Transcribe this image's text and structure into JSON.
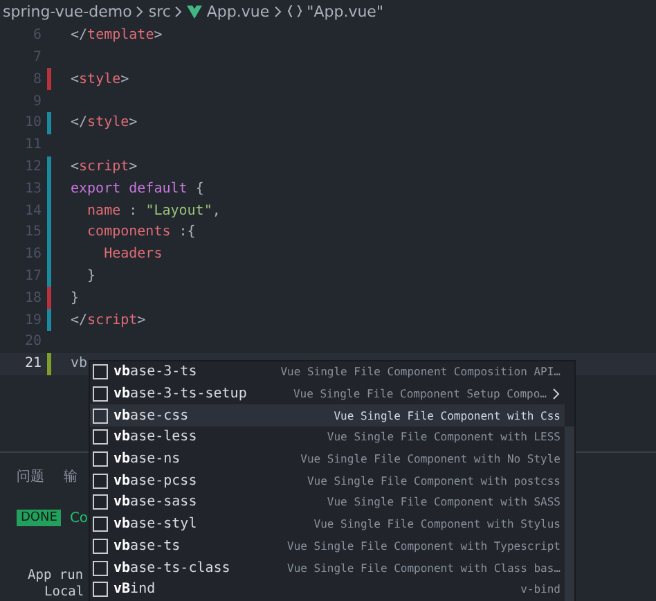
{
  "breadcrumb": [
    {
      "kind": "folder",
      "label": "spring-vue-demo"
    },
    {
      "kind": "folder",
      "label": "src"
    },
    {
      "kind": "vue-file",
      "label": "App.vue"
    },
    {
      "kind": "object",
      "label": "\"App.vue\""
    }
  ],
  "code_lines": [
    {
      "number": "6",
      "tokens": [
        {
          "kind": "punct",
          "text": "</"
        },
        {
          "kind": "tag",
          "text": "template"
        },
        {
          "kind": "punct",
          "text": ">"
        }
      ]
    },
    {
      "number": "7"
    },
    {
      "number": "8",
      "color": "#b8323c",
      "tokens": [
        {
          "kind": "punct",
          "text": "<"
        },
        {
          "kind": "tag",
          "text": "style"
        },
        {
          "kind": "punct",
          "text": ">"
        }
      ]
    },
    {
      "number": "9"
    },
    {
      "number": "10",
      "color": "#1b8a9f",
      "tokens": [
        {
          "kind": "punct",
          "text": "</"
        },
        {
          "kind": "tag",
          "text": "style"
        },
        {
          "kind": "punct",
          "text": ">"
        }
      ]
    },
    {
      "number": "11"
    },
    {
      "number": "12",
      "color": "#1b8a9f",
      "tokens": [
        {
          "kind": "punct",
          "text": "<"
        },
        {
          "kind": "tag",
          "text": "script"
        },
        {
          "kind": "punct",
          "text": ">"
        }
      ]
    },
    {
      "number": "13",
      "color": "#1b8a9f",
      "tokens": [
        {
          "kind": "keyword",
          "text": "export default"
        },
        {
          "kind": "punct",
          "text": " {"
        }
      ]
    },
    {
      "number": "14",
      "color": "#1b8a9f",
      "tokens": [
        {
          "kind": "tag",
          "text": "  name"
        },
        {
          "kind": "punct",
          "text": " : "
        },
        {
          "kind": "string",
          "text": "\"Layout\""
        },
        {
          "kind": "punct",
          "text": ","
        }
      ]
    },
    {
      "number": "15",
      "color": "#1b8a9f",
      "tokens": [
        {
          "kind": "tag",
          "text": "  components"
        },
        {
          "kind": "punct",
          "text": " :{"
        }
      ]
    },
    {
      "number": "16",
      "color": "#1b8a9f",
      "tokens": [
        {
          "kind": "tag",
          "text": "    Headers"
        }
      ]
    },
    {
      "number": "17",
      "color": "#1b8a9f",
      "tokens": [
        {
          "kind": "punct",
          "text": "  }"
        }
      ]
    },
    {
      "number": "18",
      "color": "#b8323c",
      "tokens": [
        {
          "kind": "punct",
          "text": "}"
        }
      ]
    },
    {
      "number": "19",
      "color": "#1b8a9f",
      "tokens": [
        {
          "kind": "punct",
          "text": "</"
        },
        {
          "kind": "tag",
          "text": "script"
        },
        {
          "kind": "punct",
          "text": ">"
        }
      ]
    },
    {
      "number": "20"
    },
    {
      "number": "21",
      "color": "#7f9f2a",
      "current": true,
      "tokens": [
        {
          "kind": "plain",
          "text": "vb"
        }
      ]
    }
  ],
  "panel": {
    "tabs": [
      {
        "label": "问题",
        "selected": false
      },
      {
        "label": "输",
        "selected": false
      }
    ],
    "task_badge": "DONE",
    "task_text": "Co",
    "terminal_lines": [
      "App run",
      "Local"
    ]
  },
  "suggestions": [
    {
      "label": "**vb**ase-3-ts",
      "detail": "Vue Single File Component Composition API…",
      "selected": false,
      "expandable": false
    },
    {
      "label": "**vb**ase-3-ts-setup",
      "detail": "Vue Single File Component Setup Compo…",
      "selected": false,
      "expandable": true
    },
    {
      "label": "**vb**ase-css",
      "detail": "Vue Single File Component with Css",
      "selected": true,
      "expandable": false
    },
    {
      "label": "**vb**ase-less",
      "detail": "Vue Single File Component with LESS",
      "selected": false,
      "expandable": false
    },
    {
      "label": "**vb**ase-ns",
      "detail": "Vue Single File Component with No Style",
      "selected": false,
      "expandable": false
    },
    {
      "label": "**vb**ase-pcss",
      "detail": "Vue Single File Component with postcss",
      "selected": false,
      "expandable": false
    },
    {
      "label": "**vb**ase-sass",
      "detail": "Vue Single File Component with SASS",
      "selected": false,
      "expandable": false
    },
    {
      "label": "**vb**ase-styl",
      "detail": "Vue Single File Component with Stylus",
      "selected": false,
      "expandable": false
    },
    {
      "label": "**vb**ase-ts",
      "detail": "Vue Single File Component with Typescript",
      "selected": false,
      "expandable": false
    },
    {
      "label": "**vb**ase-ts-class",
      "detail": "Vue Single File Component with Class bas…",
      "selected": false,
      "expandable": false
    },
    {
      "label": "**vB**ind",
      "detail": "v-bind",
      "selected": false,
      "expandable": false
    }
  ]
}
